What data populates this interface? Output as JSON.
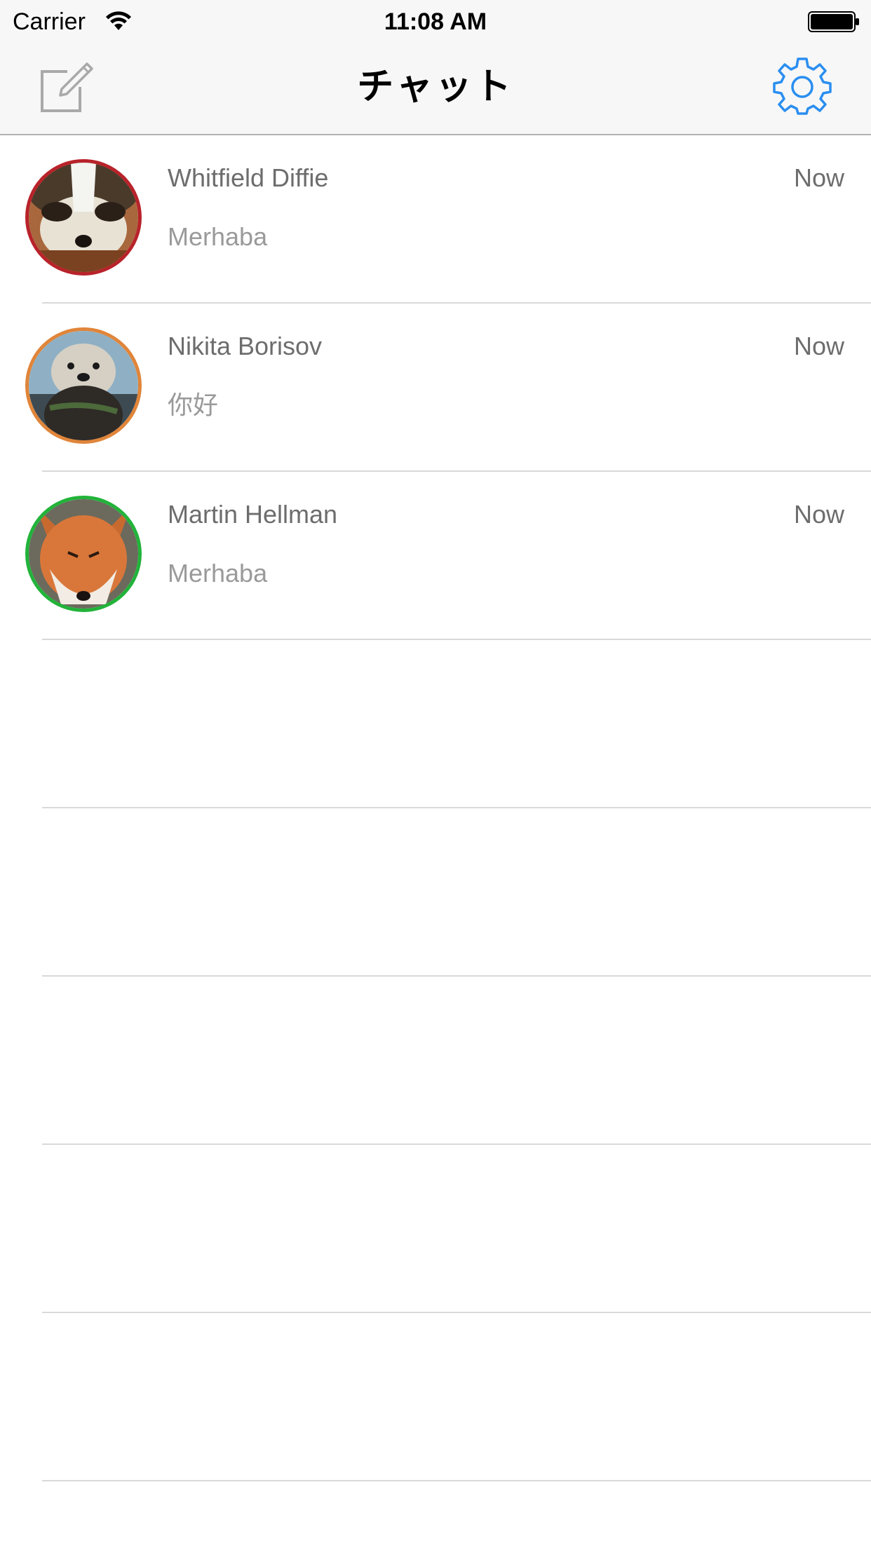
{
  "status_bar": {
    "carrier": "Carrier",
    "time": "11:08 AM",
    "wifi_icon": "wifi-icon",
    "battery_icon": "battery-icon"
  },
  "nav": {
    "title": "チャット",
    "compose_icon": "compose-icon",
    "settings_icon": "gear-icon",
    "accent_color": "#2a8ef0"
  },
  "chats": [
    {
      "name": "Whitfield Diffie",
      "time": "Now",
      "preview": "Merhaba",
      "ring_color": "#b8232a",
      "avatar": "badger"
    },
    {
      "name": "Nikita Borisov",
      "time": "Now",
      "preview": "你好",
      "ring_color": "#e0853a",
      "avatar": "otter"
    },
    {
      "name": "Martin Hellman",
      "time": "Now",
      "preview": "Merhaba",
      "ring_color": "#22b33a",
      "avatar": "fox"
    }
  ]
}
